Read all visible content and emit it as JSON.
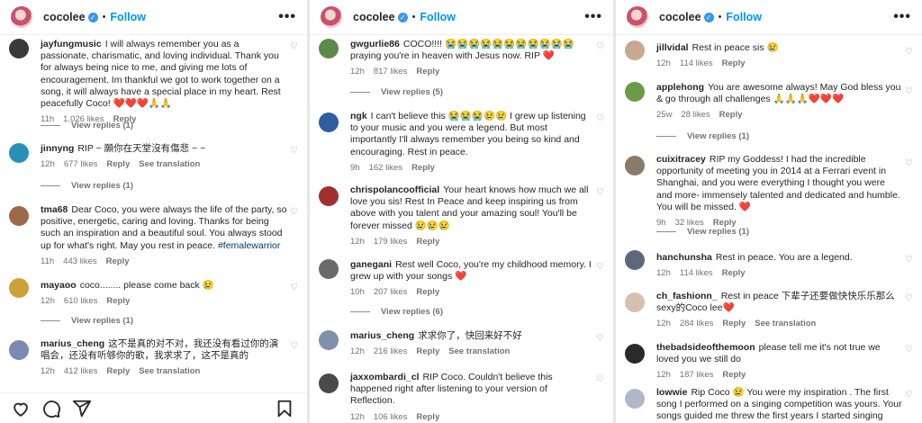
{
  "post_owner": {
    "username": "cocolee",
    "follow_label": "Follow",
    "more_label": "•••"
  },
  "panels": [
    {
      "comments": [
        {
          "user": "jayfungmusic",
          "text": "I will always remember you as a passionate, charismatic, and loving individual. Thank you for always being nice to me, and giving me lots of encouragement. Im thankful we got to work together on a song, it will always have a special place in my heart. Rest peacefully Coco! ❤️❤️❤️🙏🙏",
          "time": "11h",
          "likes": "1,026 likes",
          "reply": "Reply",
          "translate": "",
          "view_replies": "View replies (1)"
        },
        {
          "user": "jinnyng",
          "text": "RIP ~ 願你在天堂沒有傷悲 ~ ~",
          "time": "12h",
          "likes": "677 likes",
          "reply": "Reply",
          "translate": "See translation",
          "view_replies": "View replies (1)"
        },
        {
          "user": "tma68",
          "text": "Dear Coco, you were always the life of the party, so positive, energetic, caring and loving. Thanks for being such an inspiration and a beautiful soul. You always stood up for what's right. May you rest in peace.",
          "tag": "#femalewarrior",
          "time": "11h",
          "likes": "443 likes",
          "reply": "Reply",
          "translate": "",
          "view_replies": ""
        },
        {
          "user": "mayaoo",
          "text": "coco........ please come back 😢",
          "time": "12h",
          "likes": "610 likes",
          "reply": "Reply",
          "translate": "",
          "view_replies": "View replies (1)"
        },
        {
          "user": "marius_cheng",
          "text": "这不是真的对不对，我还没有看过你的演唱会，还没有听够你的歌，我求求了，这不是真的",
          "time": "12h",
          "likes": "412 likes",
          "reply": "Reply",
          "translate": "See translation",
          "view_replies": ""
        }
      ]
    },
    {
      "comments": [
        {
          "user": "gwgurlie86",
          "text": "COCO!!!! 😭😭😭😭😭😭😭😭😭😭😭 praying you're in heaven with Jesus now. RIP ❤️",
          "time": "12h",
          "likes": "817 likes",
          "reply": "Reply",
          "translate": "",
          "view_replies": "View replies (5)"
        },
        {
          "user": "ngk",
          "text": "I can't believe this 😭😭😭😢😢 I grew up listening to your music and you were a legend. But most importantly I'll always remember you being so kind and encouraging. Rest in peace.",
          "time": "9h",
          "likes": "162 likes",
          "reply": "Reply",
          "translate": "",
          "view_replies": ""
        },
        {
          "user": "chrispolancoofficial",
          "text": "Your heart knows how much we all love you sis! Rest In Peace and keep inspiring us from above with you talent and your amazing soul! You'll be forever missed 😢😢😢",
          "time": "12h",
          "likes": "179 likes",
          "reply": "Reply",
          "translate": "",
          "view_replies": ""
        },
        {
          "user": "ganegani",
          "text": "Rest well Coco, you're my childhood memory. I grew up with your songs ❤️",
          "time": "10h",
          "likes": "207 likes",
          "reply": "Reply",
          "translate": "",
          "view_replies": "View replies (6)"
        },
        {
          "user": "marius_cheng",
          "text": "求求你了，快回来好不好",
          "time": "12h",
          "likes": "216 likes",
          "reply": "Reply",
          "translate": "See translation",
          "view_replies": ""
        },
        {
          "user": "jaxxombardi_cl",
          "text": "RIP Coco. Couldn't believe this happened right after listening to your version of Reflection.",
          "time": "12h",
          "likes": "106 likes",
          "reply": "Reply",
          "translate": "",
          "view_replies": ""
        }
      ]
    },
    {
      "comments": [
        {
          "user": "jillvidal",
          "text": "Rest in peace sis 😢",
          "time": "12h",
          "likes": "114 likes",
          "reply": "Reply",
          "translate": "",
          "view_replies": ""
        },
        {
          "user": "applehong",
          "text": "You are awesome always! May God bless you & go through all challenges 🙏🙏🙏❤️❤️❤️",
          "time": "25w",
          "likes": "28 likes",
          "reply": "Reply",
          "translate": "",
          "view_replies": "View replies (1)"
        },
        {
          "user": "cuixitracey",
          "text": "RIP my Goddess! I had the incredible opportunity of meeting you in 2014 at a Ferrari event in Shanghai, and you were everything I thought you were and more- immensely talented and dedicated and humble. You will be missed. ❤️",
          "time": "9h",
          "likes": "32 likes",
          "reply": "Reply",
          "translate": "",
          "view_replies": "View replies (1)"
        },
        {
          "user": "hanchunsha",
          "text": "Rest in peace. You are a legend.",
          "time": "12h",
          "likes": "114 likes",
          "reply": "Reply",
          "translate": "",
          "view_replies": ""
        },
        {
          "user": "ch_fashionn_",
          "text": "Rest in peace 下辈子还要做快快乐乐那么sexy的Coco lee❤️",
          "time": "12h",
          "likes": "284 likes",
          "reply": "Reply",
          "translate": "See translation",
          "view_replies": ""
        },
        {
          "user": "thebadsideofthemoon",
          "text": "please tell me it's not true we loved you we still do",
          "time": "12h",
          "likes": "187 likes",
          "reply": "Reply",
          "translate": "",
          "view_replies": ""
        },
        {
          "user": "lowwie",
          "text": "Rip Coco 😢 You were my inspiration . The first song I performed on a singing competition was yours. Your songs guided me threw the first years I started singing",
          "time": "",
          "likes": "",
          "reply": "",
          "translate": "",
          "view_replies": ""
        }
      ]
    }
  ],
  "avatar_colors": [
    "#3a3a3a",
    "#2a8fb8",
    "#9a6a4a",
    "#c9a23a",
    "#7a8ab0",
    "#5b8a4b",
    "#2e5e9e",
    "#a03030",
    "#6a6a6a",
    "#8090a8",
    "#4a4a4a",
    "#c8a890",
    "#6a9a4a",
    "#8a7a6a",
    "#5a6a7a",
    "#d8c0b0",
    "#2a2a2a",
    "#b0b8c8"
  ],
  "actions": {
    "like": "heart-icon",
    "comment": "comment-icon",
    "share": "share-icon",
    "save": "bookmark-icon"
  }
}
